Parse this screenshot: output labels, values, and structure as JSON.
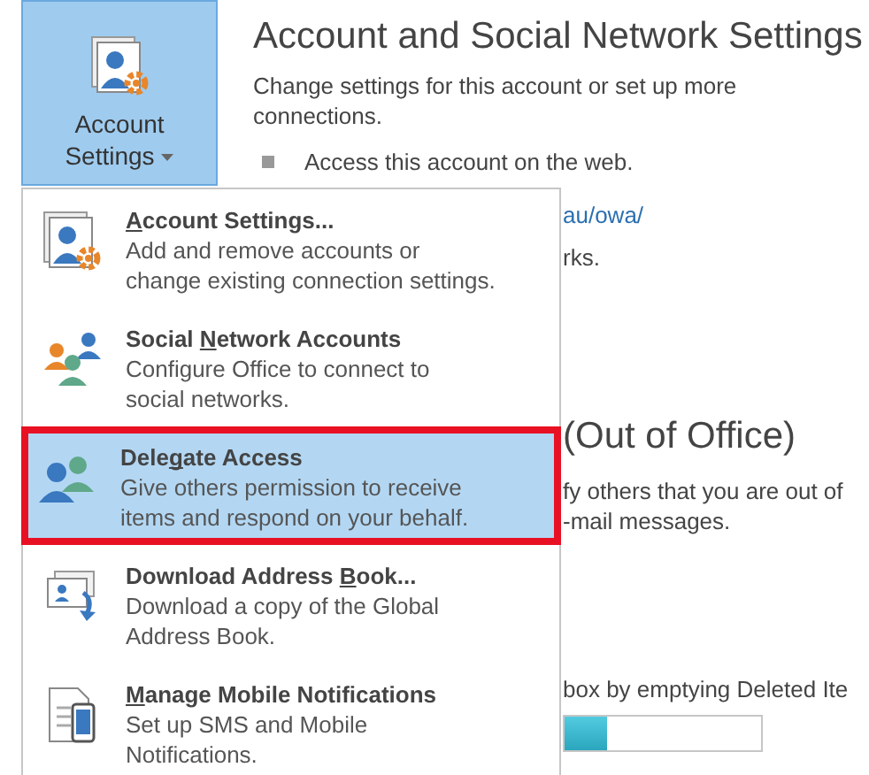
{
  "ribbon_button": {
    "label": "Account Settings",
    "selected": true
  },
  "section": {
    "title": "Account and Social Network Settings",
    "description_lines": [
      "Change settings for this account or set up more",
      "connections."
    ],
    "bullet": "Access this account on the web.",
    "link": "au/owa/",
    "text_2": "rks."
  },
  "section_2": {
    "title": "(Out of Office)",
    "description_lines": [
      "fy others that you are out of",
      "-mail messages."
    ]
  },
  "section_3": {
    "description": "box by emptying Deleted Ite",
    "level": 0.22
  },
  "menu": {
    "items": [
      {
        "kind": "account-settings",
        "title_parts": [
          {
            "text": "A",
            "underline": true
          },
          {
            "text": "ccount Settings...",
            "underline": false
          }
        ],
        "description_lines": [
          "Add and remove accounts or",
          "change existing connection settings."
        ],
        "selected": false
      },
      {
        "kind": "social-network",
        "title_parts": [
          {
            "text": "Social ",
            "underline": false
          },
          {
            "text": "N",
            "underline": true
          },
          {
            "text": "etwork Accounts",
            "underline": false
          }
        ],
        "description_lines": [
          "Configure Office to connect to",
          "social networks."
        ],
        "selected": false
      },
      {
        "kind": "delegate",
        "title_parts": [
          {
            "text": "Dele",
            "underline": false
          },
          {
            "text": "g",
            "underline": true
          },
          {
            "text": "ate Access",
            "underline": false
          }
        ],
        "description_lines": [
          "Give others permission to receive",
          "items and respond on your behalf."
        ],
        "selected": true
      },
      {
        "kind": "address-book",
        "title_parts": [
          {
            "text": "Download Address ",
            "underline": false
          },
          {
            "text": "B",
            "underline": true
          },
          {
            "text": "ook...",
            "underline": false
          }
        ],
        "description_lines": [
          "Download a copy of the Global",
          "Address Book."
        ],
        "selected": false
      },
      {
        "kind": "mobile",
        "title_parts": [
          {
            "text": "M",
            "underline": true
          },
          {
            "text": "anage Mobile Notifications",
            "underline": false
          }
        ],
        "description_lines": [
          "Set up SMS and Mobile",
          "Notifications."
        ],
        "selected": false
      }
    ]
  }
}
